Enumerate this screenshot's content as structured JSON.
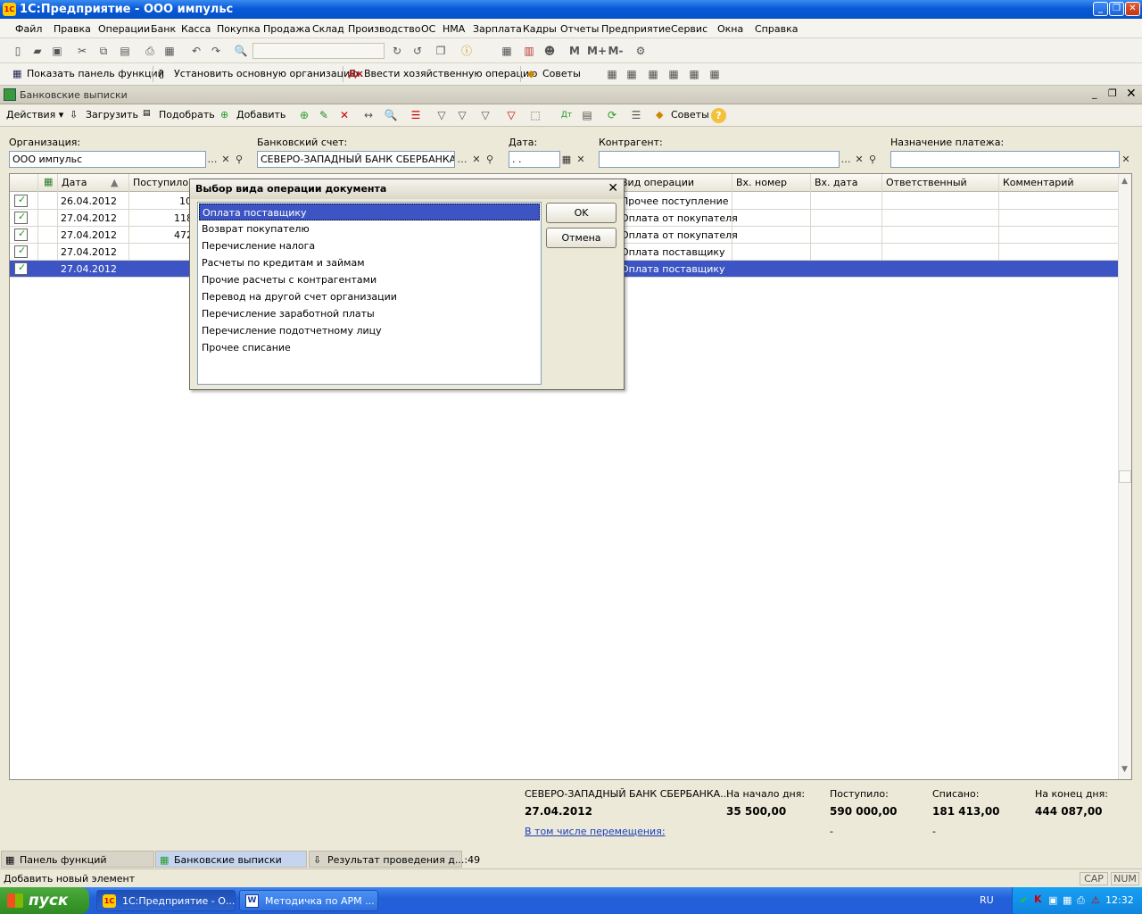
{
  "window": {
    "title": "1С:Предприятие - ООО импульс"
  },
  "menu": [
    "Файл",
    "Правка",
    "Операции",
    "Банк",
    "Касса",
    "Покупка",
    "Продажа",
    "Склад",
    "Производство",
    "ОС",
    "НМА",
    "Зарплата",
    "Кадры",
    "Отчеты",
    "Предприятие",
    "Сервис",
    "Окна",
    "Справка"
  ],
  "toolbar2": {
    "show_panel": "Показать панель функций",
    "set_org": "Установить основную организацию",
    "enter_op": "Ввести хозяйственную операцию",
    "tips": "Советы"
  },
  "doc": {
    "title": "Банковские выписки",
    "actions": "Действия",
    "load": "Загрузить",
    "pick": "Подобрать",
    "add": "Добавить",
    "tips": "Советы"
  },
  "filters": {
    "org_label": "Организация:",
    "org_value": "ООО импульс",
    "account_label": "Банковский счет:",
    "account_value": "СЕВЕРО-ЗАПАДНЫЙ БАНК СБЕРБАНКА Р",
    "date_label": "Дата:",
    "date_value": ". .",
    "contractor_label": "Контрагент:",
    "contractor_value": "",
    "purpose_label": "Назначение платежа:",
    "purpose_value": ""
  },
  "grid": {
    "columns": [
      "Дата",
      "Поступило",
      "Вид операции",
      "Вх. номер",
      "Вх. дата",
      "Ответственный",
      "Комментарий"
    ],
    "rows": [
      {
        "date": "26.04.2012",
        "income": "10",
        "op": "Прочее поступление"
      },
      {
        "date": "27.04.2012",
        "income": "118",
        "op": "Оплата от покупателя"
      },
      {
        "date": "27.04.2012",
        "income": "472",
        "op": "Оплата от покупателя"
      },
      {
        "date": "27.04.2012",
        "income": "",
        "op": "Оплата поставщику"
      },
      {
        "date": "27.04.2012",
        "income": "",
        "op": "Оплата поставщику"
      }
    ]
  },
  "dialog": {
    "title": "Выбор вида операции документа",
    "items": [
      "Оплата поставщику",
      "Возврат покупателю",
      "Перечисление налога",
      "Расчеты по кредитам и займам",
      "Прочие расчеты с контрагентами",
      "Перевод на другой счет организации",
      "Перечисление заработной платы",
      "Перечисление подотчетному лицу",
      "Прочее списание"
    ],
    "ok": "OK",
    "cancel": "Отмена"
  },
  "summary": {
    "bank": "СЕВЕРО-ЗАПАДНЫЙ БАНК СБЕРБАНКА...",
    "date": "27.04.2012",
    "start_label": "На начало дня:",
    "start_value": "35 500,00",
    "in_label": "Поступило:",
    "in_value": "590 000,00",
    "in_sub": "-",
    "out_label": "Списано:",
    "out_value": "181 413,00",
    "out_sub": "-",
    "end_label": "На конец дня:",
    "end_value": "444 087,00",
    "link": "В том числе перемещения:"
  },
  "tabs": [
    "Панель функций",
    "Банковские выписки",
    "Результат проведения д...:49"
  ],
  "status": {
    "text": "Добавить новый элемент",
    "cap": "CAP",
    "num": "NUM"
  },
  "taskbar": {
    "start": "пуск",
    "items": [
      "1С:Предприятие - О...",
      "Методичка по АРМ ..."
    ],
    "lang": "RU",
    "clock": "12:32"
  }
}
